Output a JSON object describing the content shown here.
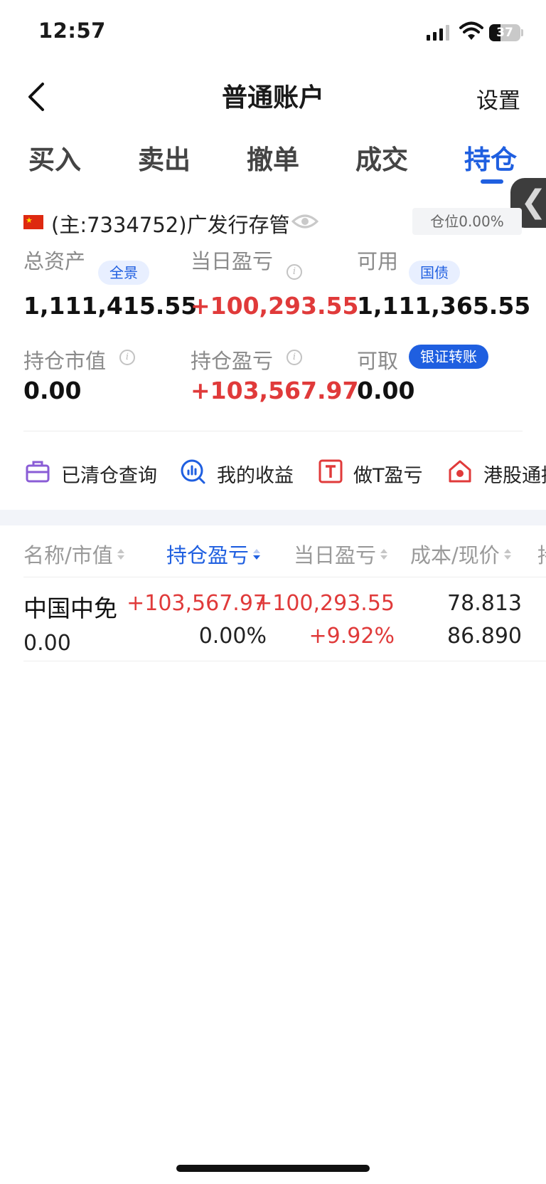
{
  "status_bar": {
    "time": "12:57",
    "battery": "37",
    "battery_level": 0.37
  },
  "header": {
    "title": "普通账户",
    "settings": "设置"
  },
  "tabs": [
    {
      "label": "买入"
    },
    {
      "label": "卖出"
    },
    {
      "label": "撤单"
    },
    {
      "label": "成交"
    },
    {
      "label": "持仓"
    }
  ],
  "active_tab": "持仓",
  "account": {
    "name": "(主:7334752)广发行存管",
    "position_badge": "仓位0.00%"
  },
  "stats": {
    "total_assets": {
      "label": "总资产",
      "tag": "全景",
      "value": "1,111,415.55"
    },
    "daily_pl": {
      "label": "当日盈亏",
      "value": "+100,293.55"
    },
    "available": {
      "label": "可用",
      "tag": "国债",
      "value": "1,111,365.55"
    },
    "market_value": {
      "label": "持仓市值",
      "value": "0.00"
    },
    "position_pl": {
      "label": "持仓盈亏",
      "value": "+103,567.97"
    },
    "withdrawable": {
      "label": "可取",
      "tag": "银证转账",
      "value": "0.00"
    }
  },
  "shortcuts": [
    {
      "label": "已清仓查询",
      "icon": "briefcase-icon"
    },
    {
      "label": "我的收益",
      "icon": "chart-search-icon"
    },
    {
      "label": "做T盈亏",
      "icon": "t-box-icon"
    },
    {
      "label": "港股通持",
      "icon": "hk-home-icon"
    }
  ],
  "table": {
    "columns": [
      "名称/市值",
      "持仓盈亏",
      "当日盈亏",
      "成本/现价",
      "持"
    ],
    "rows": [
      {
        "name": "中国中免",
        "market_value": "0.00",
        "position_pl": "+103,567.97",
        "position_pl_pct": "0.00%",
        "daily_pl": "+100,293.55",
        "daily_pl_pct": "+9.92%",
        "cost": "78.813",
        "price": "86.890"
      }
    ]
  },
  "colors": {
    "accent": "#1f5fe0",
    "profit": "#e03a3a",
    "label": "#8a8a8a"
  }
}
